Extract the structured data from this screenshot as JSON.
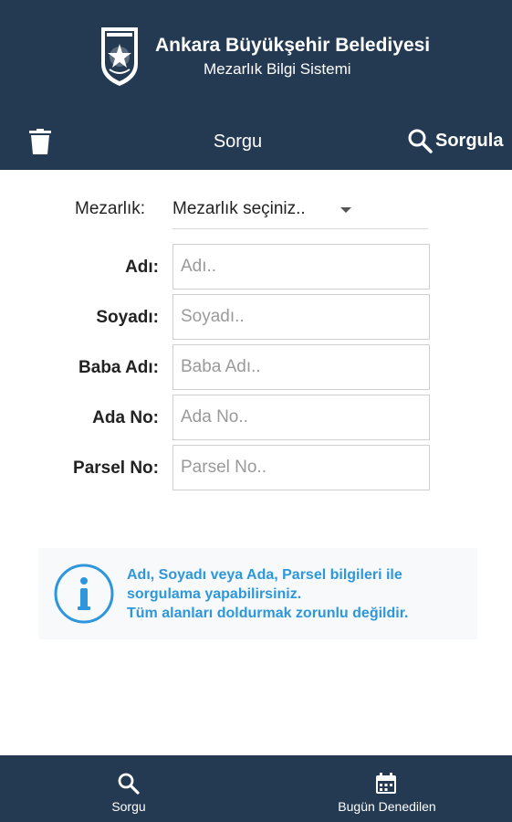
{
  "header": {
    "org_title": "Ankara Büyükşehir Belediyesi",
    "org_subtitle": "Mezarlık Bilgi Sistemi",
    "toolbar_title": "Sorgu",
    "query_label": "Sorgula",
    "colors": {
      "primary": "#233a52",
      "accent": "#2e97dc"
    }
  },
  "form": {
    "cemetery_label": "Mezarlık:",
    "cemetery_value": "Mezarlık seçiniz..",
    "fields": [
      {
        "label": "Adı:",
        "placeholder": "Adı..",
        "value": ""
      },
      {
        "label": "Soyadı:",
        "placeholder": "Soyadı..",
        "value": ""
      },
      {
        "label": "Baba Adı:",
        "placeholder": "Baba Adı..",
        "value": ""
      },
      {
        "label": "Ada No:",
        "placeholder": "Ada No..",
        "value": ""
      },
      {
        "label": "Parsel No:",
        "placeholder": "Parsel No..",
        "value": ""
      }
    ]
  },
  "info": {
    "line1": "Adı, Soyadı veya Ada, Parsel bilgileri ile",
    "line2": "sorgulama yapabilirsiniz.",
    "line3": "Tüm alanları doldurmak zorunlu değildir.",
    "icon": "info-icon"
  },
  "bottom_nav": {
    "items": [
      {
        "label": "Sorgu",
        "icon": "search-icon"
      },
      {
        "label": "Bugün Denedilen",
        "icon": "calendar-icon"
      }
    ]
  }
}
